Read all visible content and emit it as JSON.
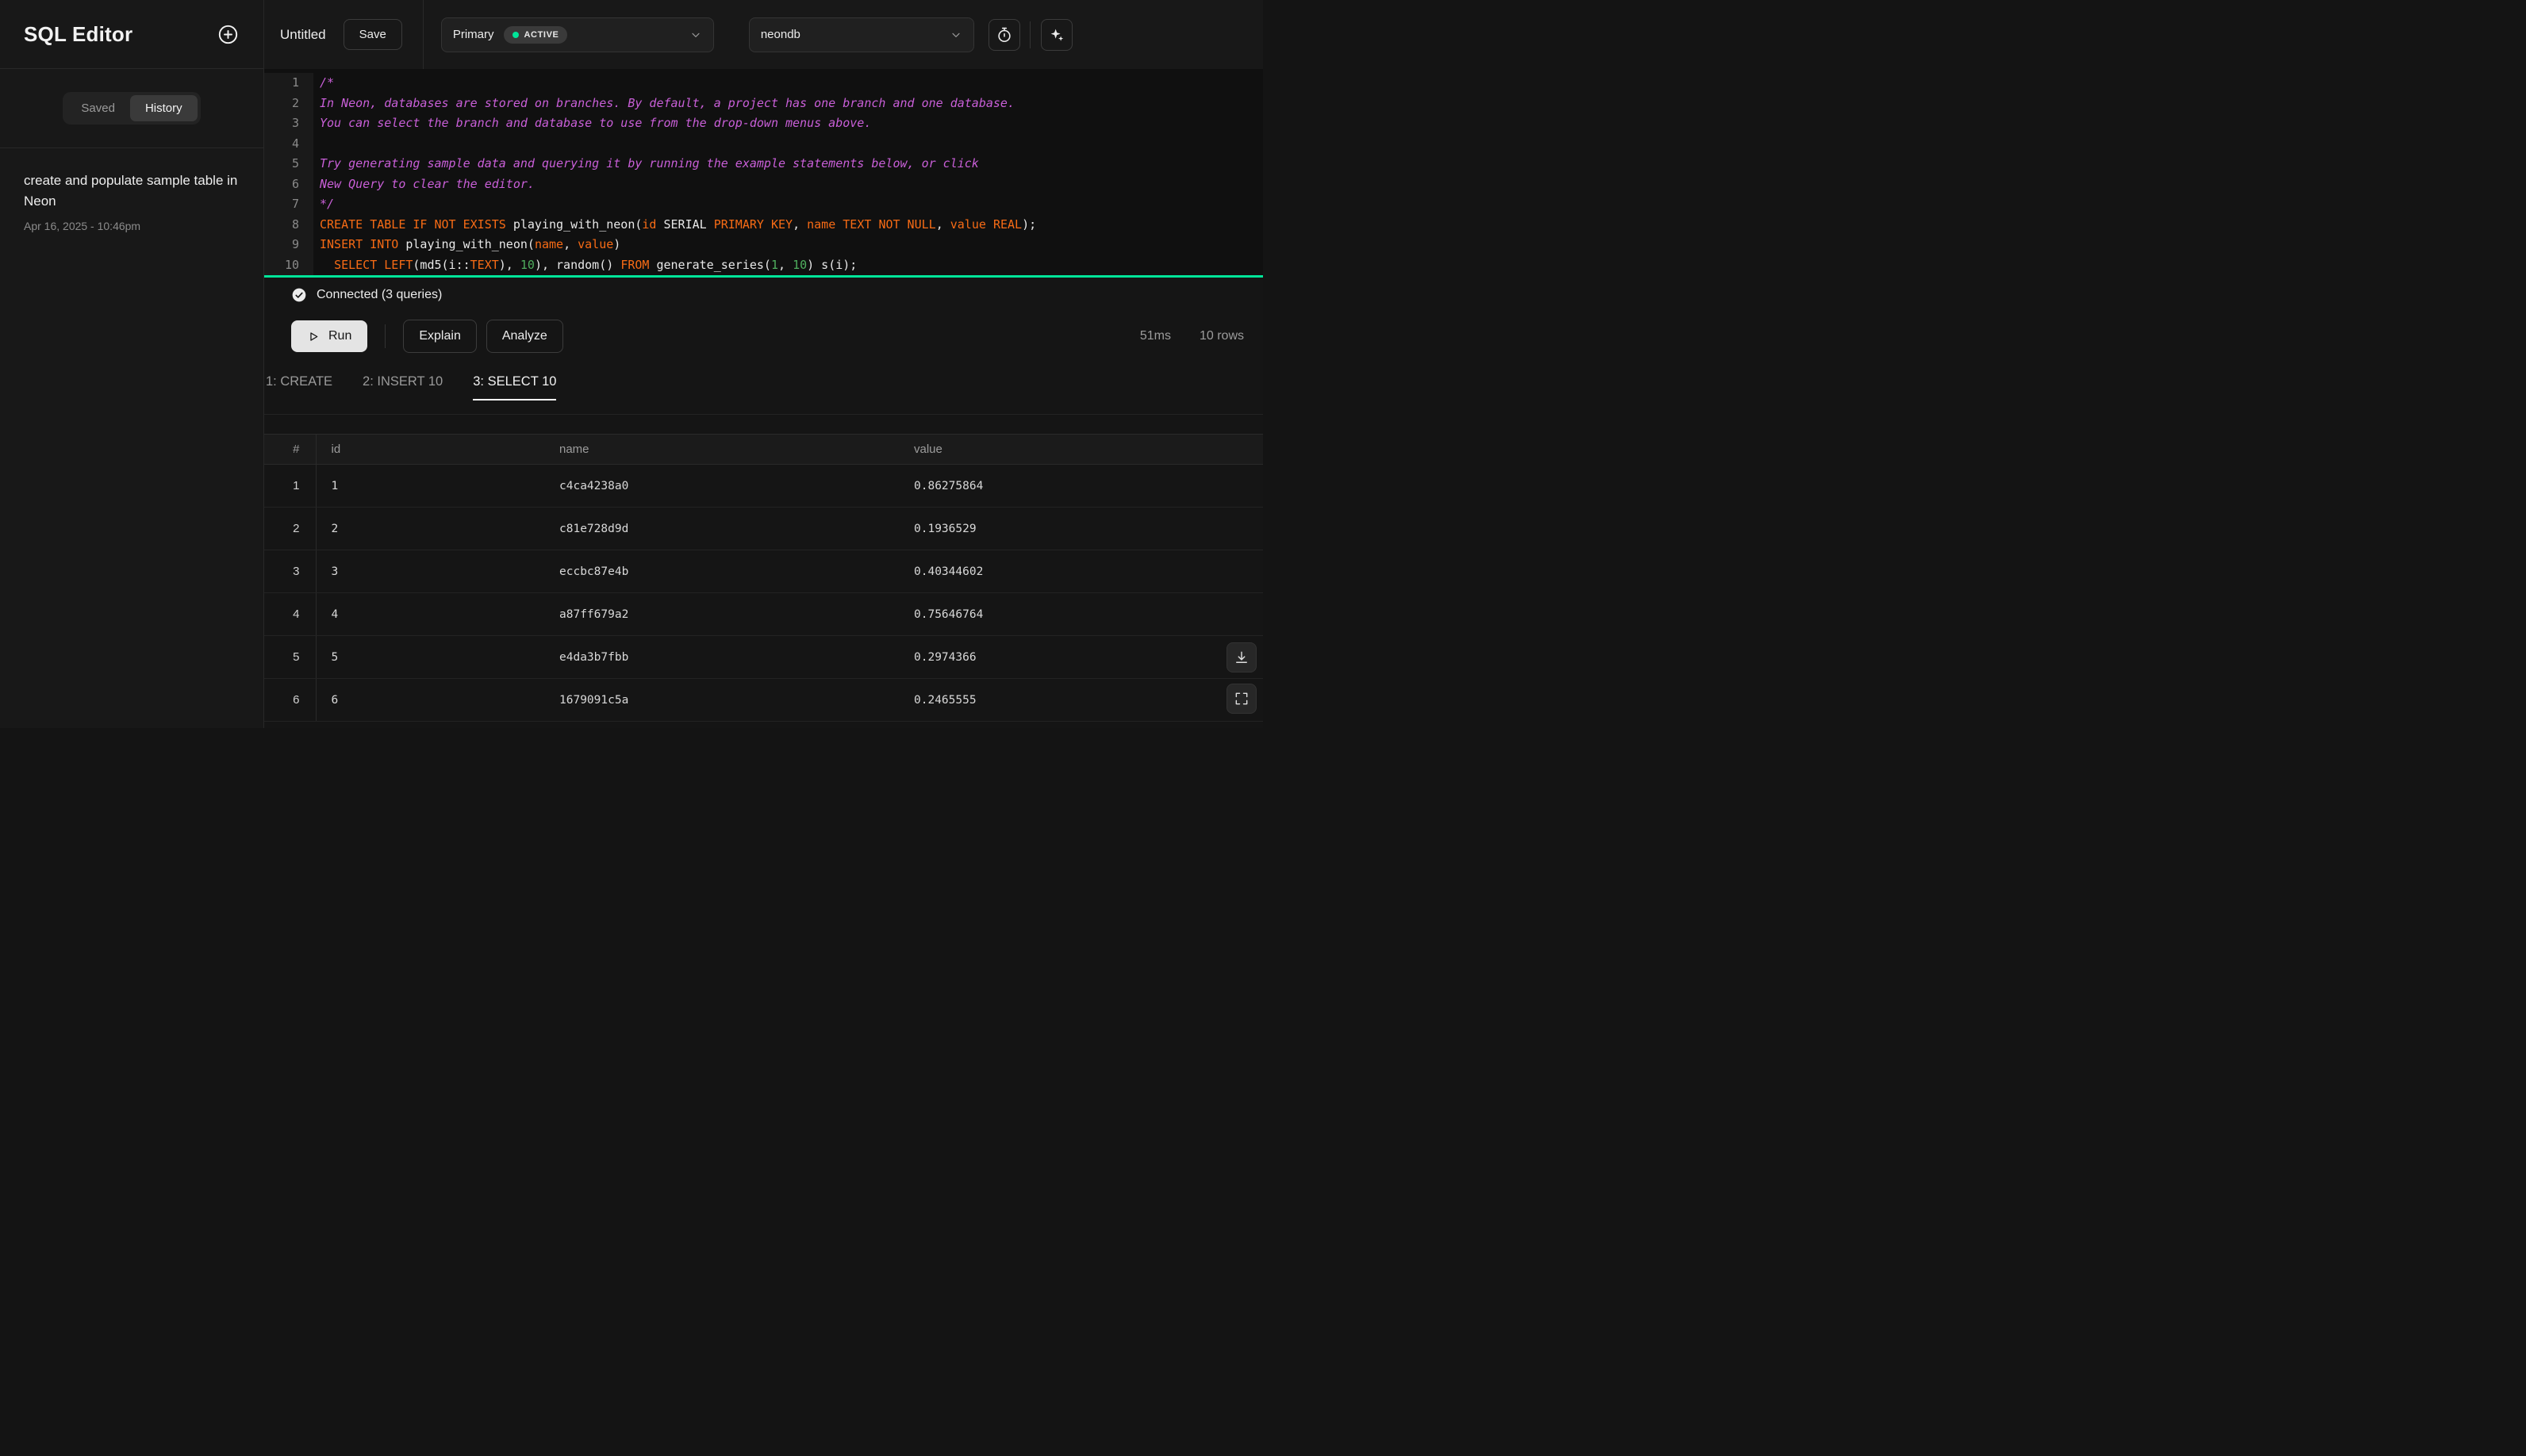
{
  "colors": {
    "accent_green": "#00e599",
    "keyword_orange": "#f76b15",
    "comment_magenta": "#c95fd8",
    "number_green": "#4fae5e"
  },
  "icons": {
    "new_query": "plus-circle",
    "branch_select": "chevron-down",
    "database_select": "chevron-down",
    "query_history": "stopwatch",
    "ai_assist": "sparkles",
    "connected": "check-circle",
    "run": "play-triangle",
    "download": "download-tray",
    "expand": "fullscreen-corners"
  },
  "sidebar": {
    "title": "SQL Editor",
    "tabs": [
      {
        "label": "Saved",
        "active": false
      },
      {
        "label": "History",
        "active": true
      }
    ],
    "history": [
      {
        "title": "create and populate sample table in Neon",
        "date": "Apr 16, 2025 - 10:46pm"
      }
    ]
  },
  "topbar": {
    "file_name": "Untitled",
    "save_label": "Save",
    "branch": {
      "name": "Primary",
      "status": "ACTIVE"
    },
    "database": "neondb"
  },
  "editor": {
    "lines": [
      [
        [
          "/*",
          "c"
        ]
      ],
      [
        [
          "In Neon, databases are stored on branches. By default, a project has one branch and one database.",
          "c"
        ]
      ],
      [
        [
          "You can select the branch and database to use from the drop-down menus above.",
          "c"
        ]
      ],
      [],
      [
        [
          "Try generating sample data and querying it by running the example statements below, or click",
          "c"
        ]
      ],
      [
        [
          "New Query to clear the editor.",
          "c"
        ]
      ],
      [
        [
          "*/",
          "c"
        ]
      ],
      [
        [
          "CREATE TABLE IF NOT EXISTS",
          "k"
        ],
        [
          " playing_with_neon(",
          "p"
        ],
        [
          "id",
          "k"
        ],
        [
          " SERIAL ",
          "p"
        ],
        [
          "PRIMARY KEY",
          "k"
        ],
        [
          ", ",
          "p"
        ],
        [
          "name",
          "k"
        ],
        [
          " ",
          "p"
        ],
        [
          "TEXT",
          "k"
        ],
        [
          " ",
          "p"
        ],
        [
          "NOT NULL",
          "k"
        ],
        [
          ", ",
          "p"
        ],
        [
          "value",
          "k"
        ],
        [
          " ",
          "p"
        ],
        [
          "REAL",
          "k"
        ],
        [
          ");",
          "p"
        ]
      ],
      [
        [
          "INSERT INTO",
          "k"
        ],
        [
          " playing_with_neon(",
          "p"
        ],
        [
          "name",
          "k"
        ],
        [
          ", ",
          "p"
        ],
        [
          "value",
          "k"
        ],
        [
          ")",
          "p"
        ]
      ],
      [
        [
          "  ",
          "p"
        ],
        [
          "SELECT",
          "k"
        ],
        [
          " ",
          "p"
        ],
        [
          "LEFT",
          "k"
        ],
        [
          "(md5(i::",
          "p"
        ],
        [
          "TEXT",
          "k"
        ],
        [
          "), ",
          "p"
        ],
        [
          "10",
          "n"
        ],
        [
          "), random() ",
          "p"
        ],
        [
          "FROM",
          "k"
        ],
        [
          " generate_series(",
          "p"
        ],
        [
          "1",
          "n"
        ],
        [
          ", ",
          "p"
        ],
        [
          "10",
          "n"
        ],
        [
          ") s(i);",
          "p"
        ]
      ]
    ]
  },
  "status": {
    "connected_label": "Connected (3 queries)"
  },
  "toolbar": {
    "run": "Run",
    "explain": "Explain",
    "analyze": "Analyze",
    "duration": "51ms",
    "rows": "10 rows"
  },
  "result_tabs": [
    {
      "label": "1: CREATE",
      "active": false
    },
    {
      "label": "2: INSERT 10",
      "active": false
    },
    {
      "label": "3: SELECT 10",
      "active": true
    }
  ],
  "table": {
    "columns": [
      "#",
      "id",
      "name",
      "value"
    ],
    "rows": [
      [
        "1",
        "1",
        "c4ca4238a0",
        "0.86275864"
      ],
      [
        "2",
        "2",
        "c81e728d9d",
        "0.1936529"
      ],
      [
        "3",
        "3",
        "eccbc87e4b",
        "0.40344602"
      ],
      [
        "4",
        "4",
        "a87ff679a2",
        "0.75646764"
      ],
      [
        "5",
        "5",
        "e4da3b7fbb",
        "0.2974366"
      ],
      [
        "6",
        "6",
        "1679091c5a",
        "0.2465555"
      ]
    ]
  }
}
